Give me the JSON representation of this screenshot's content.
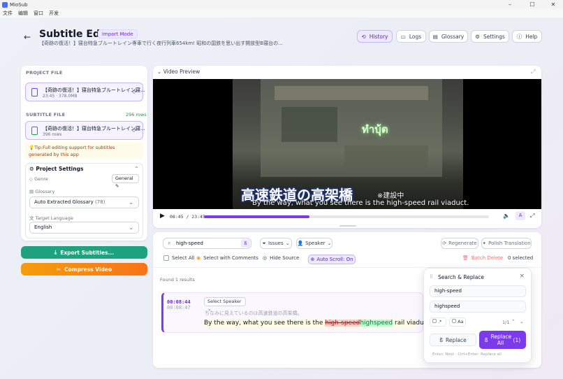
{
  "window": {
    "title": "MioSub"
  },
  "menu": [
    "文件",
    "编辑",
    "窗口",
    "开发"
  ],
  "header": {
    "title": "Subtitle Editor",
    "mode_badge": "Import Mode",
    "subtitle": "【奇跡の復活！】寝台特急ブルートレイン専車で行く夜行列車654km! 昭和の国鉄を思い出す開放型B寝台の...",
    "buttons": {
      "history": "History",
      "logs": "Logs",
      "glossary": "Glossary",
      "settings": "Settings",
      "help": "Help"
    }
  },
  "project_file": {
    "label": "PROJECT FILE",
    "name": "【奇跡の復活！】寝台特急ブルートレイン寝...",
    "meta": "23:45 · 378.0MB"
  },
  "subtitle_file": {
    "label": "SUBTITLE FILE",
    "rows_badge": "296 rows",
    "name": "【奇跡の復活！】寝台特急ブルートレイン寝...",
    "meta": "396 rows"
  },
  "tip": "Tip:Full editing support for subtitles generated by this app",
  "project_settings": {
    "title": "Project Settings",
    "genre_label": "Genre",
    "genre_value": "General",
    "glossary_label": "Glossary",
    "glossary_value": "Auto Extracted Glossary",
    "glossary_count": "(78)",
    "target_language_label": "Target Language",
    "target_language_value": "English"
  },
  "actions": {
    "export": "Export Subtitles...",
    "compress": "Compress Video"
  },
  "video": {
    "title": "Video Preview",
    "subtitle_jp": "高速鉄道の高架橋",
    "subtitle_jp_small": "※建設中",
    "subtitle_en": "By the way, what you see there is the high-speed rail viaduct.",
    "neon_text": "ทำบุ้ต",
    "time": "08:45 / 23:45",
    "progress": 0.37
  },
  "editor": {
    "search_value": "high-speed",
    "issues_label": "Issues",
    "speaker_label": "Speaker",
    "regenerate_label": "Regenerate",
    "polish_label": "Polish Translation",
    "select_all": "Select All",
    "select_with_comments": "Select with Comments",
    "hide_source": "Hide Source",
    "auto_scroll": "Auto Scroll: On",
    "batch_delete": "Batch Delete",
    "selected_count": "0 selected",
    "results_text": "Found 1 results"
  },
  "entry": {
    "start": "00:08:44",
    "end": "00:08:47",
    "speaker_select": "Select Speaker",
    "source": "ちなみに見えているのは高速鉄道の高架橋。",
    "translation_prefix": "By the way, what you see there is the ",
    "old_text": "high-speed",
    "new_text": "highspeed",
    "translation_suffix": " rail viaduct."
  },
  "search_replace": {
    "title": "Search & Replace",
    "find_value": "high-speed",
    "replace_value": "highspeed",
    "regex_label": ".*",
    "case_label": "Aa",
    "match_count": "1/1",
    "replace_button": "Replace",
    "replace_all_button": "Replace All",
    "replace_all_count": "(1)",
    "hint": "Enter: Next · Ctrl+Enter: Replace all"
  }
}
